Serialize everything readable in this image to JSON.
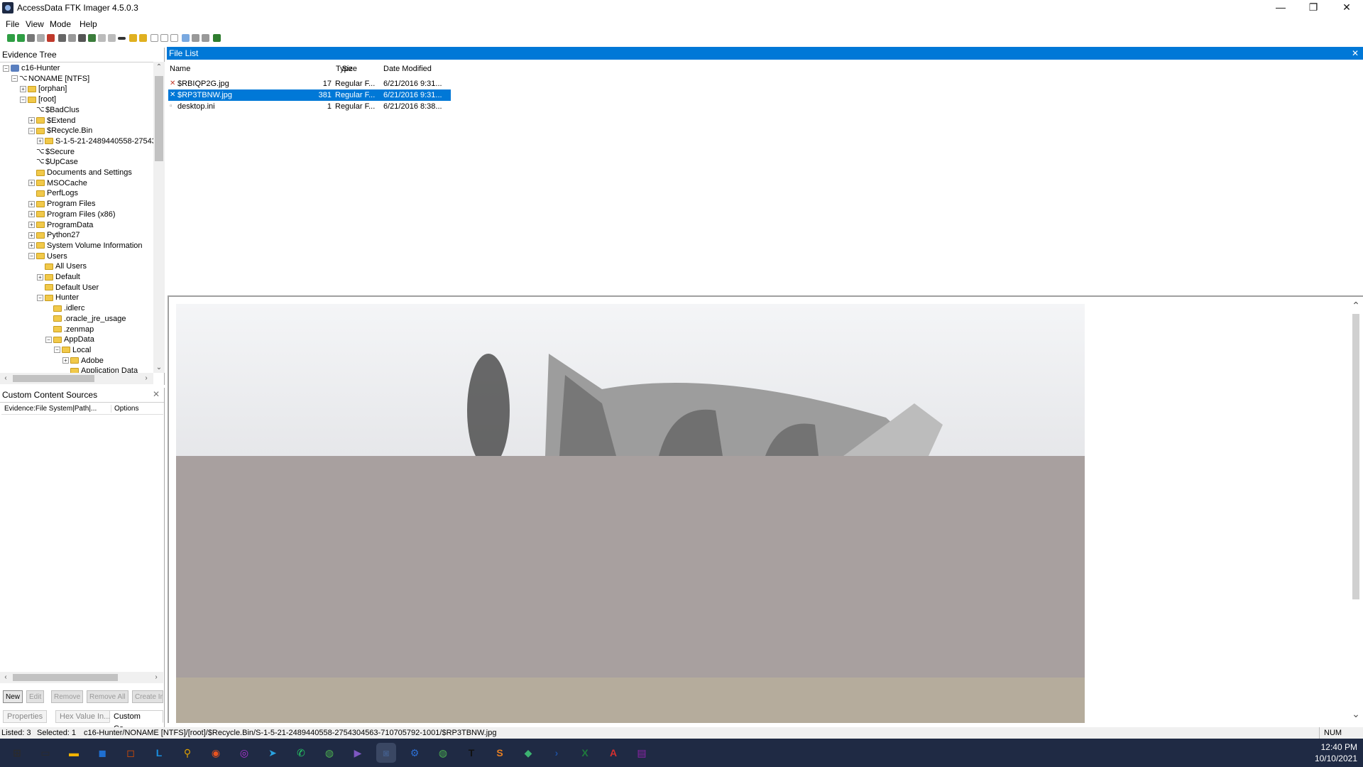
{
  "window": {
    "title": "AccessData FTK Imager 4.5.0.3",
    "min_glyph": "—",
    "max_glyph": "❐",
    "close_glyph": "✕"
  },
  "menu": [
    "File",
    "View",
    "Mode",
    "Help"
  ],
  "evidence_tree": {
    "title": "Evidence Tree",
    "items": [
      {
        "label": "c16-Hunter",
        "exp": "−",
        "icon": "drive"
      },
      {
        "label": "NONAME [NTFS]",
        "exp": "−",
        "icon": "sys"
      },
      {
        "label": "[orphan]",
        "exp": "+",
        "icon": "folder"
      },
      {
        "label": "[root]",
        "exp": "−",
        "icon": "folder"
      },
      {
        "label": "$BadClus",
        "exp": "",
        "icon": "sys"
      },
      {
        "label": "$Extend",
        "exp": "+",
        "icon": "folder"
      },
      {
        "label": "$Recycle.Bin",
        "exp": "−",
        "icon": "folder"
      },
      {
        "label": "S-1-5-21-2489440558-27543",
        "exp": "+",
        "icon": "folder"
      },
      {
        "label": "$Secure",
        "exp": "",
        "icon": "sys"
      },
      {
        "label": "$UpCase",
        "exp": "",
        "icon": "sys"
      },
      {
        "label": "Documents and Settings",
        "exp": "",
        "icon": "folder"
      },
      {
        "label": "MSOCache",
        "exp": "+",
        "icon": "folder"
      },
      {
        "label": "PerfLogs",
        "exp": "",
        "icon": "folder"
      },
      {
        "label": "Program Files",
        "exp": "+",
        "icon": "folder"
      },
      {
        "label": "Program Files (x86)",
        "exp": "+",
        "icon": "folder"
      },
      {
        "label": "ProgramData",
        "exp": "+",
        "icon": "folder"
      },
      {
        "label": "Python27",
        "exp": "+",
        "icon": "folder"
      },
      {
        "label": "System Volume Information",
        "exp": "+",
        "icon": "folder"
      },
      {
        "label": "Users",
        "exp": "−",
        "icon": "folder"
      },
      {
        "label": "All Users",
        "exp": "",
        "icon": "folder"
      },
      {
        "label": "Default",
        "exp": "+",
        "icon": "folder"
      },
      {
        "label": "Default User",
        "exp": "",
        "icon": "folder"
      },
      {
        "label": "Hunter",
        "exp": "−",
        "icon": "folder"
      },
      {
        "label": ".idlerc",
        "exp": "",
        "icon": "folder"
      },
      {
        "label": ".oracle_jre_usage",
        "exp": "",
        "icon": "folder"
      },
      {
        "label": ".zenmap",
        "exp": "",
        "icon": "folder"
      },
      {
        "label": "AppData",
        "exp": "−",
        "icon": "folder"
      },
      {
        "label": "Local",
        "exp": "−",
        "icon": "folder"
      },
      {
        "label": "Adobe",
        "exp": "+",
        "icon": "folder"
      },
      {
        "label": "Application Data",
        "exp": "",
        "icon": "folder"
      }
    ]
  },
  "custom_content": {
    "title": "Custom Content Sources",
    "col_evidence": "Evidence:File System|Path|...",
    "col_options": "Options",
    "buttons": [
      "New",
      "Edit",
      "Remove",
      "Remove All",
      "Create In"
    ],
    "tabs": [
      "Properties",
      "Hex Value In...",
      "Custom Co..."
    ]
  },
  "file_list": {
    "title": "File List",
    "columns": [
      "Name",
      "Size",
      "Type",
      "Date Modified"
    ],
    "rows": [
      {
        "name": "$RBIQP2G.jpg",
        "size": "17",
        "type": "Regular F...",
        "date": "6/21/2016 9:31..."
      },
      {
        "name": "$RP3TBNW.jpg",
        "size": "381",
        "type": "Regular F...",
        "date": "6/21/2016 9:31..."
      },
      {
        "name": "desktop.ini",
        "size": "1",
        "type": "Regular F...",
        "date": "6/21/2016 8:38..."
      }
    ]
  },
  "status": {
    "listed": "Listed: 3",
    "selected": "Selected: 1",
    "path": "c16-Hunter/NONAME [NTFS]/[root]/$Recycle.Bin/S-1-5-21-2489440558-2754304563-710705792-1001/$RP3TBNW.jpg",
    "num": "NUM"
  },
  "taskbar": {
    "time": "12:40 PM",
    "date": "10/10/2021",
    "apps": [
      "start",
      "task-view",
      "file-explorer",
      "store",
      "office",
      "libreoffice",
      "search-tool",
      "ubuntu",
      "messenger",
      "telegram",
      "whatsapp",
      "chrome",
      "media-player",
      "ftk-imager",
      "settings",
      "chrome-alt",
      "typora",
      "sublime",
      "git",
      "powershell",
      "excel",
      "acrobat",
      "winrar"
    ]
  }
}
